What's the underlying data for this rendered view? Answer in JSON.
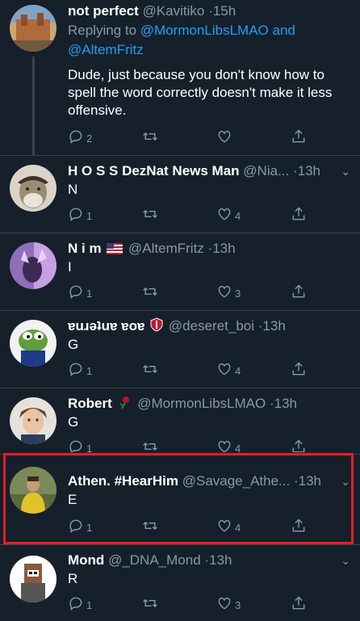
{
  "tweets": [
    {
      "name": "not perfect",
      "handle": "@Kavitiko",
      "time": "15h",
      "replying_prefix": "Replying to",
      "replying_to_1": "@MormonLibsLMAO",
      "replying_and": "and",
      "replying_to_2": "@AltemFritz",
      "text": "Dude, just because you don't know how to spell the word correctly doesn't make it less offensive.",
      "replies": "2",
      "retweets": "",
      "likes": ""
    },
    {
      "name": "H O S S DezNat News Man",
      "handle": "@Nia...",
      "time": "13h",
      "text": "N",
      "replies": "1",
      "retweets": "",
      "likes": "4"
    },
    {
      "name": "N i m",
      "flag_icon": "us-flag-icon",
      "handle": "@AltemFritz",
      "time": "13h",
      "text": "I",
      "replies": "1",
      "retweets": "",
      "likes": "3"
    },
    {
      "name": "ɐuɹǝʇuɐ ɐoɐ",
      "badge_icon": "shield-icon",
      "handle": "@deseret_boi",
      "time": "13h",
      "text": "G",
      "replies": "1",
      "retweets": "",
      "likes": "4"
    },
    {
      "name": "Robert",
      "badge_icon": "rose-icon",
      "handle": "@MormonLibsLMAO",
      "time": "13h",
      "text": "G",
      "replies": "1",
      "retweets": "",
      "likes": "4"
    },
    {
      "name": "Athen. #HearHim",
      "handle": "@Savage_Athe...",
      "time": "13h",
      "text": "E",
      "replies": "1",
      "retweets": "",
      "likes": "4"
    },
    {
      "name": "Mond",
      "handle": "@_DNA_Mond",
      "time": "13h",
      "text": "R",
      "replies": "1",
      "retweets": "",
      "likes": "3"
    }
  ],
  "separator": "·",
  "colors": {
    "background": "#15202b",
    "text": "#ffffff",
    "secondary": "#8899a6",
    "link": "#1da1f2",
    "highlight": "#e0202a"
  }
}
